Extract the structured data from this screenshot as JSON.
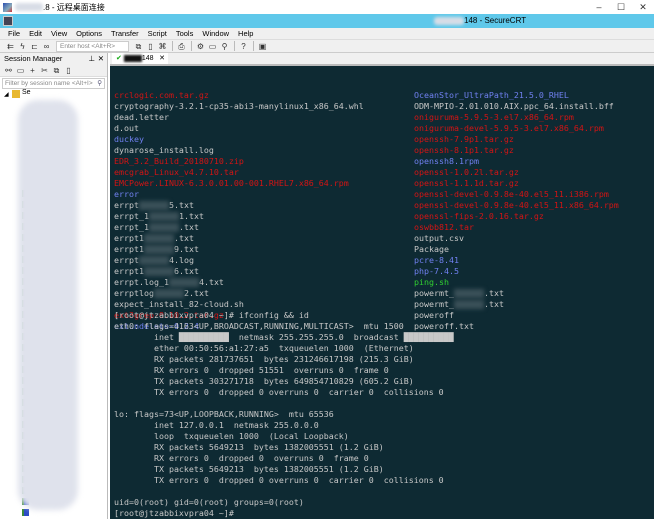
{
  "window": {
    "title_suffix": ".8 - 远程桌面连接",
    "app_title": "148 - SecureCRT",
    "min": "–",
    "max": "☐",
    "close": "✕"
  },
  "menu": [
    "File",
    "Edit",
    "View",
    "Options",
    "Transfer",
    "Script",
    "Tools",
    "Window",
    "Help"
  ],
  "toolbar": {
    "host_placeholder": "Enter host <Alt+R>"
  },
  "session_manager": {
    "title": "Session Manager",
    "pin": "⊥",
    "close": "✕",
    "filter_placeholder": "Filter by session name <Alt+I>",
    "root": "Se"
  },
  "tab": {
    "label": "148",
    "check": "✔",
    "close": "✕"
  },
  "colors": {
    "terminal_bg": "#0e2a33",
    "file": "#c8c8c8",
    "archive": "#d41414",
    "directory": "#7080f0",
    "executable": "#30d030"
  },
  "files_left": [
    {
      "t": "crclogic.com.tar.gz",
      "c": "red"
    },
    {
      "t": "cryptography-3.2.1-cp35-abi3-manylinux1_x86_64.whl",
      "c": "gray"
    },
    {
      "t": "dead.letter",
      "c": "gray"
    },
    {
      "t": "d.out",
      "c": "gray"
    },
    {
      "t": "duckey",
      "c": "blue"
    },
    {
      "t": "dynarose_install.log",
      "c": "gray"
    },
    {
      "t": "EDR_3.2_Build_20180710.zip",
      "c": "red"
    },
    {
      "t": "emcgrab_Linux_v4.7.10.tar",
      "c": "red"
    },
    {
      "t": "EMCPower.LINUX-6.3.0.01.00-001.RHEL7.x86_64.rpm",
      "c": "red"
    },
    {
      "t": "error",
      "c": "blue"
    },
    {
      "t": "errpt",
      "post": "5.txt",
      "c": "gray"
    },
    {
      "t": "errpt_1",
      "post": "1.txt",
      "c": "gray"
    },
    {
      "t": "errpt_1",
      "post": ".txt",
      "c": "gray"
    },
    {
      "t": "errpt1",
      "post": ".txt",
      "c": "gray"
    },
    {
      "t": "errpt1",
      "post": "9.txt",
      "c": "gray"
    },
    {
      "t": "errpt",
      "post": "4.log",
      "c": "gray"
    },
    {
      "t": "errpt1",
      "post": "6.txt",
      "c": "gray"
    },
    {
      "t": "errpt.log_1",
      "post": "4.txt",
      "c": "gray"
    },
    {
      "t": "errptlog",
      "post": "2.txt",
      "c": "gray"
    },
    {
      "t": "expect_install_82-cloud.sh",
      "c": "gray"
    },
    {
      "t": "ext3grep-0.10.2.tar.gz",
      "c": "red"
    },
    {
      "t": "extundelete-0.2.4",
      "c": "blue"
    }
  ],
  "files_right": [
    {
      "t": "OceanStor_UltraPath_21.5.0_RHEL",
      "c": "blue"
    },
    {
      "t": "ODM-MPIO-2.01.010.AIX.ppc_64.install.bff",
      "c": "gray"
    },
    {
      "t": "oniguruma-5.9.5-3.el7.x86_64.rpm",
      "c": "red"
    },
    {
      "t": "oniguruma-devel-5.9.5-3.el7.x86_64.rpm",
      "c": "red"
    },
    {
      "t": "openssh-7.9p1.tar.gz",
      "c": "red"
    },
    {
      "t": "openssh-8.1p1.tar.gz",
      "c": "red"
    },
    {
      "t": "openssh8.1rpm",
      "c": "blue"
    },
    {
      "t": "openssl-1.0.2l.tar.gz",
      "c": "red"
    },
    {
      "t": "openssl-1.1.1d.tar.gz",
      "c": "red"
    },
    {
      "t": "openssl-devel-0.9.8e-40.el5_11.i386.rpm",
      "c": "red"
    },
    {
      "t": "openssl-devel-0.9.8e-40.el5_11.x86_64.rpm",
      "c": "red"
    },
    {
      "t": "openssl-fips-2.0.16.tar.gz",
      "c": "red"
    },
    {
      "t": "oswbb812.tar",
      "c": "red"
    },
    {
      "t": "output.csv",
      "c": "gray"
    },
    {
      "t": "Package",
      "c": "gray"
    },
    {
      "t": "pcre-8.41",
      "c": "blue"
    },
    {
      "t": "php-7.4.5",
      "c": "blue"
    },
    {
      "t": "ping.sh",
      "c": "green"
    },
    {
      "t": "powermt_",
      "post": ".txt",
      "c": "gray"
    },
    {
      "t": "powermt_",
      "post": ".txt",
      "c": "gray"
    },
    {
      "t": "poweroff",
      "c": "gray"
    },
    {
      "t": "poweroff.txt",
      "c": "gray"
    }
  ],
  "output": [
    "[root@jtzabbixvpra04 ~]# ifconfig && id",
    "eth0: flags=4163<UP,BROADCAST,RUNNING,MULTICAST>  mtu 1500",
    "        inet ██████████  netmask 255.255.255.0  broadcast ██████████",
    "        ether 00:50:56:a1:27:a5  txqueuelen 1000  (Ethernet)",
    "        RX packets 281737651  bytes 231246617198 (215.3 GiB)",
    "        RX errors 0  dropped 51551  overruns 0  frame 0",
    "        TX packets 303271718  bytes 649854710829 (605.2 GiB)",
    "        TX errors 0  dropped 0 overruns 0  carrier 0  collisions 0",
    "",
    "lo: flags=73<UP,LOOPBACK,RUNNING>  mtu 65536",
    "        inet 127.0.0.1  netmask 255.0.0.0",
    "        loop  txqueuelen 1000  (Local Loopback)",
    "        RX packets 5649213  bytes 1382005551 (1.2 GiB)",
    "        RX errors 0  dropped 0  overruns 0  frame 0",
    "        TX packets 5649213  bytes 1382005551 (1.2 GiB)",
    "        TX errors 0  dropped 0 overruns 0  carrier 0  collisions 0",
    "",
    "uid=0(root) gid=0(root) groups=0(root)",
    "[root@jtzabbixvpra04 ~]#"
  ]
}
